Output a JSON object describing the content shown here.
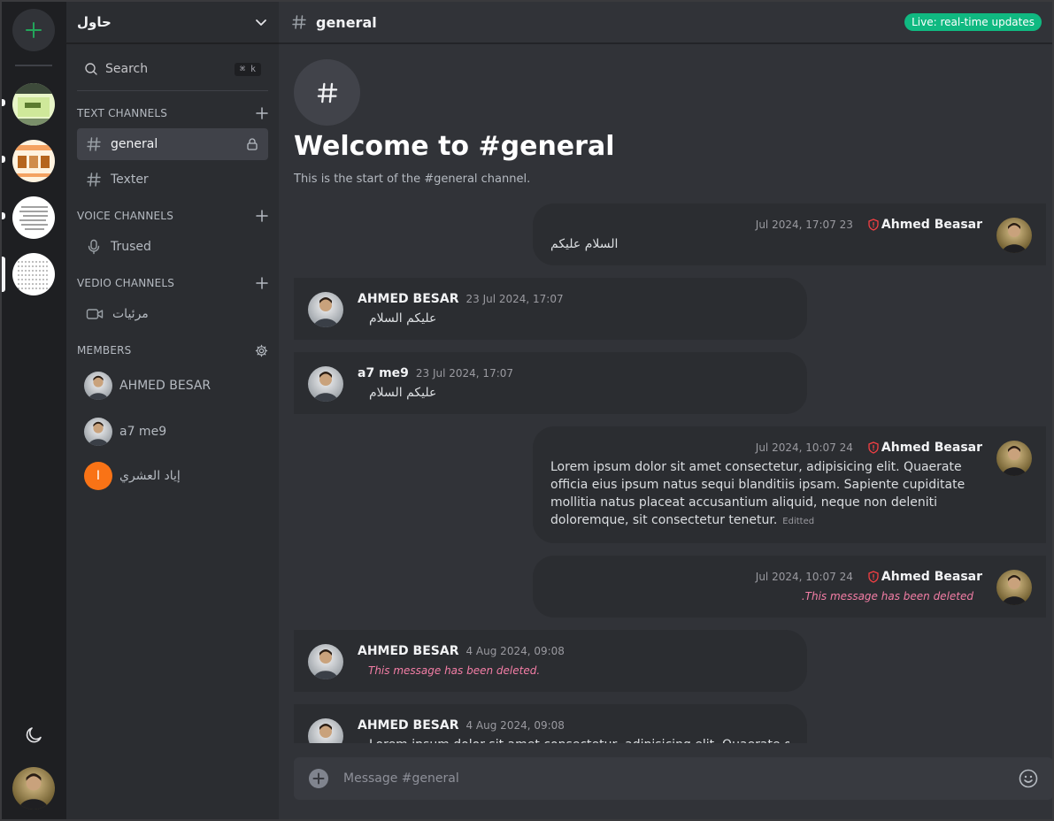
{
  "rail": {
    "add_server_icon": "plus-icon",
    "servers": [
      {
        "name": "server-1",
        "selected": false
      },
      {
        "name": "server-2",
        "selected": false
      },
      {
        "name": "server-3",
        "selected": false
      },
      {
        "name": "server-4",
        "selected": true
      }
    ],
    "theme_icon": "moon-icon"
  },
  "sidebar": {
    "server_name": "حاول",
    "search_label": "Search",
    "search_shortcut": "⌘ k",
    "text_channels_title": "TEXT CHANNELS",
    "text_channels": [
      {
        "label": "general",
        "active": true,
        "locked": true
      },
      {
        "label": "Texter",
        "active": false,
        "locked": false
      }
    ],
    "voice_channels_title": "VOICE CHANNELS",
    "voice_channels": [
      {
        "label": "Trused"
      }
    ],
    "video_channels_title": "VEDIO CHANNELS",
    "video_channels": [
      {
        "label": "مرئيات"
      }
    ],
    "members_title": "MEMBERS",
    "members": [
      {
        "name": "AHMED BESAR"
      },
      {
        "name": "a7 me9"
      },
      {
        "name": "إياد العشري",
        "initial": "I"
      }
    ]
  },
  "channel": {
    "name": "general",
    "live_badge": "Live: real-time updates",
    "welcome_title": "Welcome to #general",
    "welcome_sub": "This is the start of the #general channel."
  },
  "messages": [
    {
      "author": "Ahmed Beasar",
      "time": "Jul 2024, 17:07 23",
      "text": "السلام عليكم",
      "side": "right"
    },
    {
      "author": "AHMED BESAR",
      "time": "23 Jul 2024, 17:07",
      "text": "عليكم السلام",
      "side": "left"
    },
    {
      "author": "a7 me9",
      "time": "23 Jul 2024, 17:07",
      "text": "عليكم السلام",
      "side": "left"
    },
    {
      "author": "Ahmed Beasar",
      "time": "Jul 2024, 10:07 24",
      "text": "Lorem ipsum dolor sit amet consectetur, adipisicing elit. Quaerate officia eius ipsum natus sequi blanditiis ipsam. Sapiente cupiditate mollitia natus placeat accusantium aliquid, neque non deleniti doloremque, sit consectetur tenetur.",
      "edited": "Editted",
      "side": "right"
    },
    {
      "author": "Ahmed Beasar",
      "time": "Jul 2024, 10:07 24",
      "text": ".This message has been deleted",
      "side": "right"
    },
    {
      "author": "AHMED BESAR",
      "time": "4 Aug 2024, 09:08",
      "text": "This message has been deleted.",
      "side": "left"
    },
    {
      "author": "AHMED BESAR",
      "time": "4 Aug 2024, 09:08",
      "text": "Lorem ipsum dolor sit amet consectetur, adipisicing elit. Quaerate officia",
      "side": "left"
    }
  ],
  "composer": {
    "placeholder": "Message #general"
  },
  "colors": {
    "accent_green": "#10b981",
    "deleted_pink": "#f47ea6",
    "shield_red": "#f23f43",
    "initial_orange": "#f97316"
  }
}
